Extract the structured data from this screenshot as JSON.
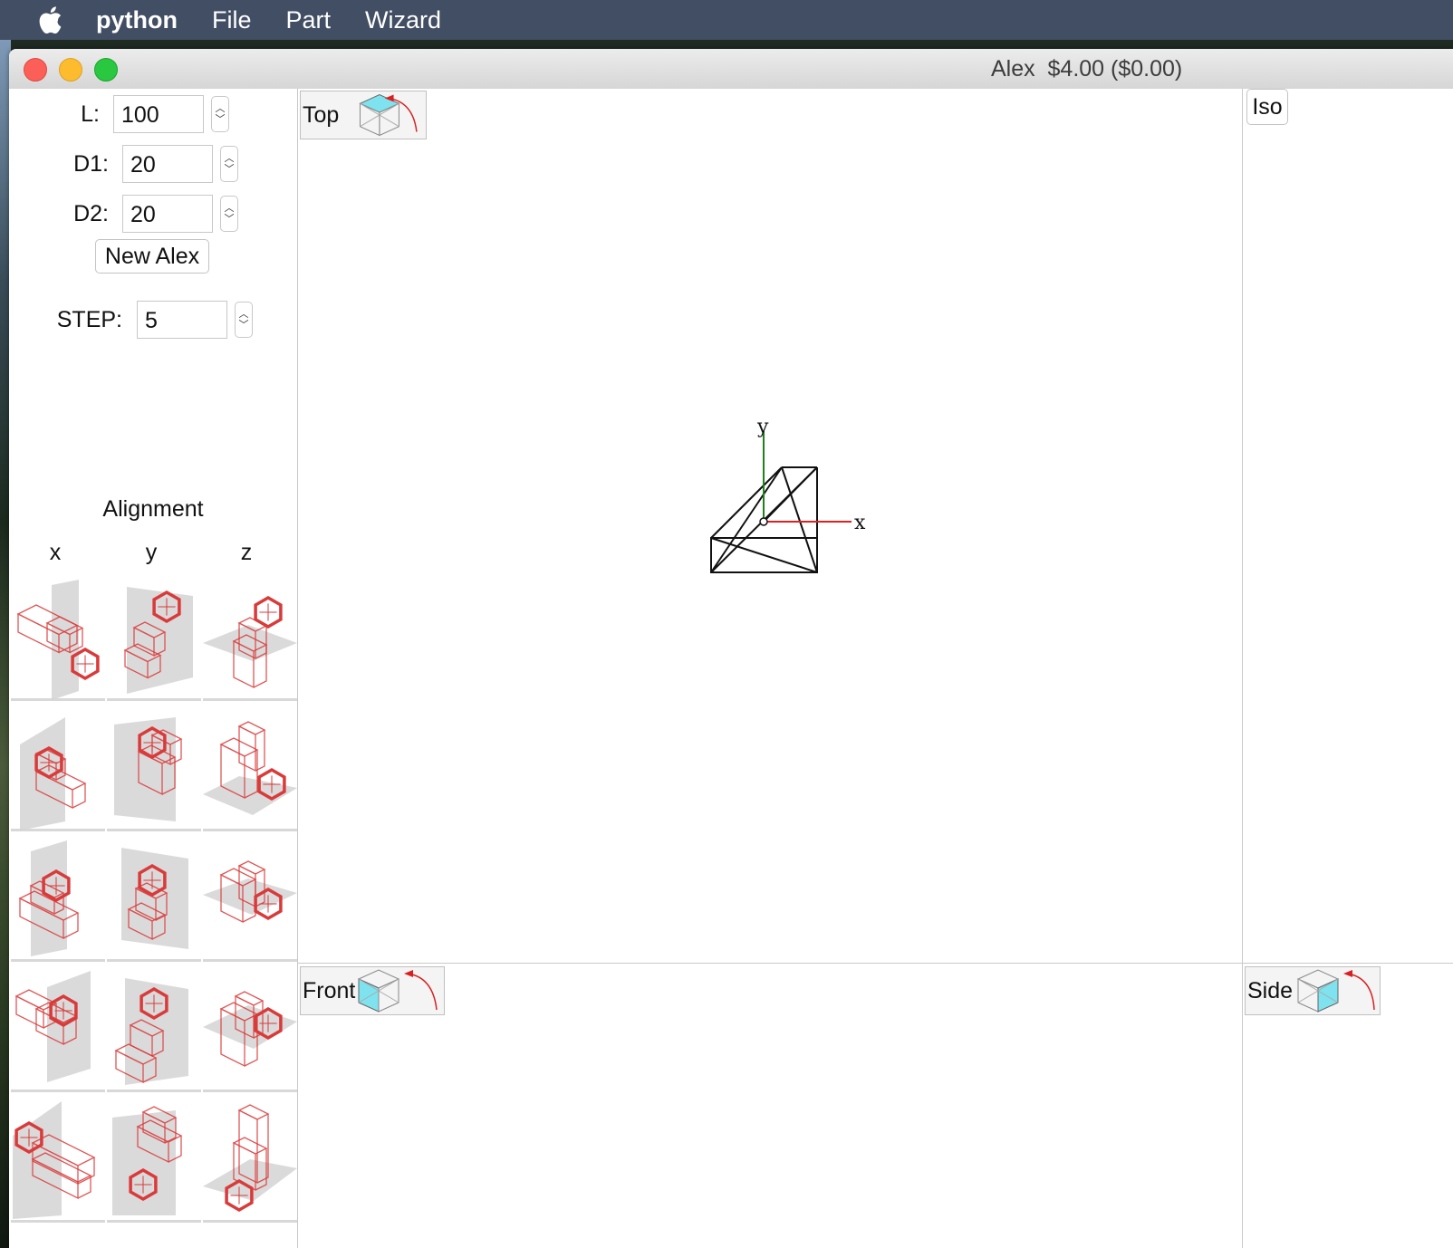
{
  "menubar": {
    "app_name": "python",
    "items": [
      "File",
      "Part",
      "Wizard"
    ]
  },
  "window": {
    "title": "Alex  $4.00 ($0.00)"
  },
  "params": {
    "l_label": "L:",
    "l_value": "100",
    "d1_label": "D1:",
    "d1_value": "20",
    "d2_label": "D2:",
    "d2_value": "20",
    "new_button": "New Alex",
    "step_label": "STEP:",
    "step_value": "5"
  },
  "alignment": {
    "title": "Alignment",
    "axes": [
      "x",
      "y",
      "z"
    ]
  },
  "views": {
    "top_label": "Top",
    "front_label": "Front",
    "side_label": "Side",
    "iso_label": "Iso",
    "axis_x": "x",
    "axis_y": "y"
  },
  "colors": {
    "menubar": "#424e63",
    "part_wireframe": "#d93a3a",
    "view_cube_face": "#7fe3ef",
    "rotate_arrow": "#d82020",
    "axis_x": "#e02020",
    "axis_y": "#208020"
  }
}
